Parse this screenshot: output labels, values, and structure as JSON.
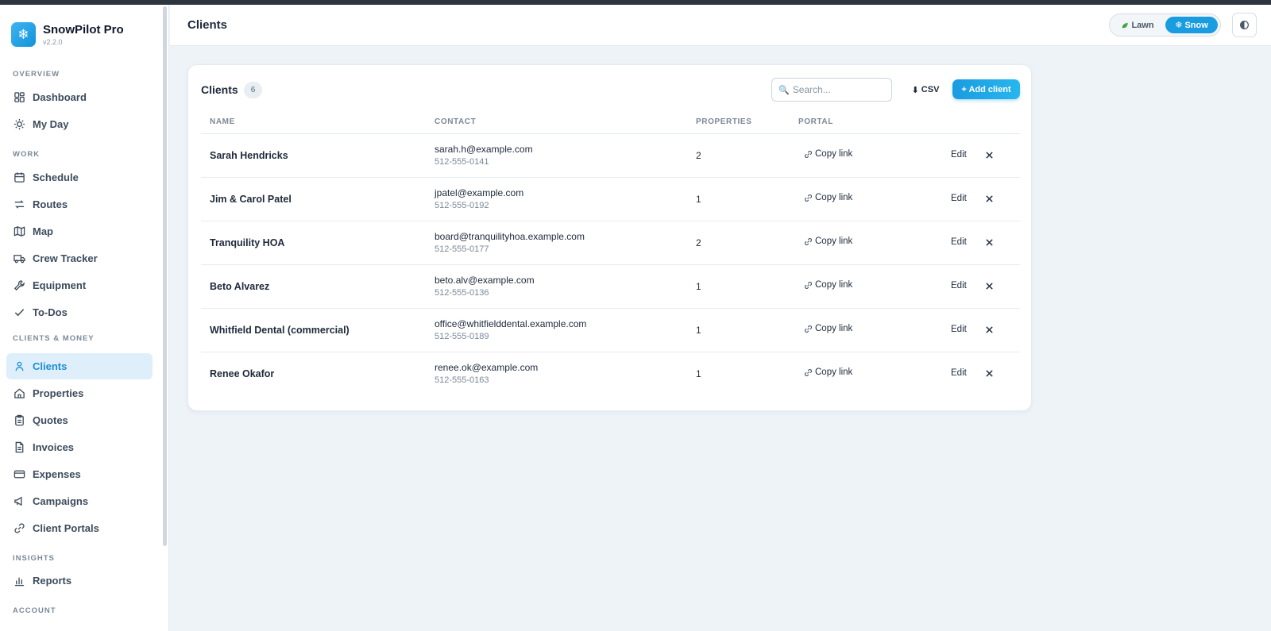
{
  "app": {
    "name": "SnowPilot Pro",
    "version": "v2.2.0"
  },
  "sidebar": {
    "sections": [
      {
        "label": "OVERVIEW"
      },
      {
        "label": "WORK"
      },
      {
        "label": "CLIENTS & MONEY"
      },
      {
        "label": "INSIGHTS"
      },
      {
        "label": "ACCOUNT"
      }
    ],
    "items": [
      {
        "label": "Dashboard",
        "icon": "dashboard-icon"
      },
      {
        "label": "My Day",
        "icon": "sun-icon"
      },
      {
        "label": "Schedule",
        "icon": "calendar-icon"
      },
      {
        "label": "Routes",
        "icon": "routes-icon"
      },
      {
        "label": "Map",
        "icon": "map-icon"
      },
      {
        "label": "Crew Tracker",
        "icon": "truck-icon"
      },
      {
        "label": "Equipment",
        "icon": "wrench-icon"
      },
      {
        "label": "To-Dos",
        "icon": "check-icon"
      },
      {
        "label": "Clients",
        "icon": "user-icon",
        "active": true
      },
      {
        "label": "Properties",
        "icon": "home-icon"
      },
      {
        "label": "Quotes",
        "icon": "clipboard-icon"
      },
      {
        "label": "Invoices",
        "icon": "document-icon"
      },
      {
        "label": "Expenses",
        "icon": "card-icon"
      },
      {
        "label": "Campaigns",
        "icon": "megaphone-icon"
      },
      {
        "label": "Client Portals",
        "icon": "link-icon"
      },
      {
        "label": "Reports",
        "icon": "bar-chart-icon"
      }
    ]
  },
  "header": {
    "title": "Clients",
    "mode_lawn": "Lawn",
    "mode_snow": "Snow",
    "active_mode": "Snow"
  },
  "card": {
    "title": "Clients",
    "count": "6",
    "search_placeholder": "Search...",
    "csv_label": "CSV",
    "add_label": "+ Add client",
    "columns": [
      "NAME",
      "CONTACT",
      "PROPERTIES",
      "PORTAL"
    ],
    "copy_label": "Copy link",
    "edit_label": "Edit",
    "rows": [
      {
        "name": "Sarah Hendricks",
        "email": "sarah.h@example.com",
        "phone": "512-555-0141",
        "properties": "2"
      },
      {
        "name": "Jim & Carol Patel",
        "email": "jpatel@example.com",
        "phone": "512-555-0192",
        "properties": "1"
      },
      {
        "name": "Tranquility HOA",
        "email": "board@tranquilityhoa.example.com",
        "phone": "512-555-0177",
        "properties": "2"
      },
      {
        "name": "Beto Alvarez",
        "email": "beto.alv@example.com",
        "phone": "512-555-0136",
        "properties": "1"
      },
      {
        "name": "Whitfield Dental (commercial)",
        "email": "office@whitfielddental.example.com",
        "phone": "512-555-0189",
        "properties": "1"
      },
      {
        "name": "Renee Okafor",
        "email": "renee.ok@example.com",
        "phone": "512-555-0163",
        "properties": "1"
      }
    ]
  },
  "colors": {
    "accent": "#1a9ce0",
    "active_bg": "#deeefa",
    "page_bg": "#eef3f8"
  }
}
